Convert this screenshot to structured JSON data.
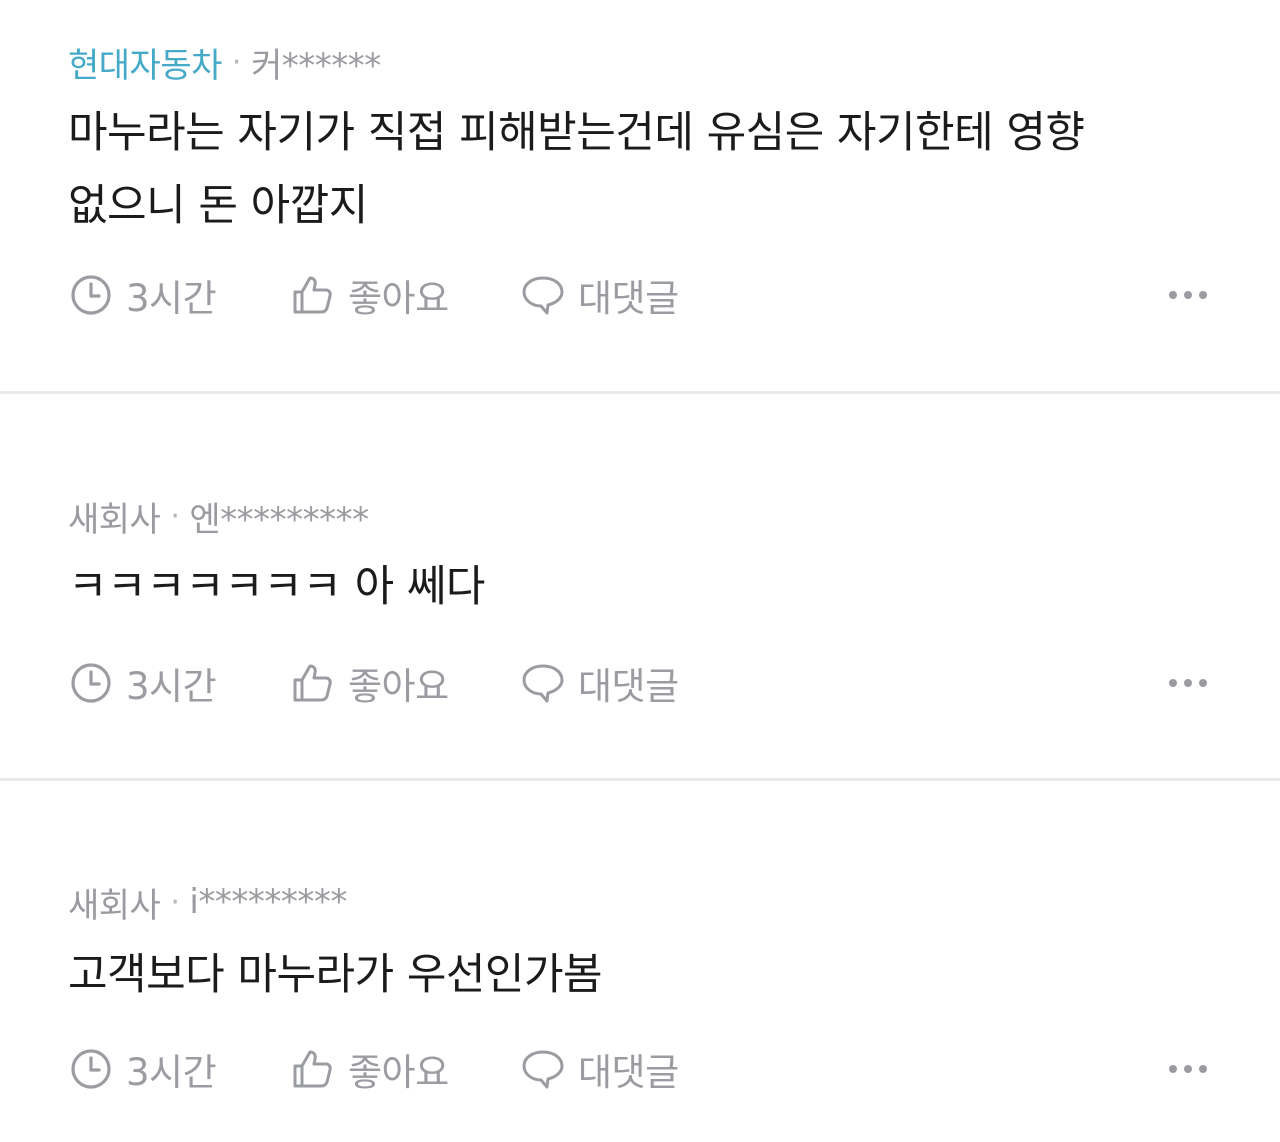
{
  "comments": [
    {
      "company": "현대자동차",
      "separator": "·",
      "author": "커******",
      "text": "마누라는 자기가 직접 피해받는건데 유심은 자기한테 영향\n없으니 돈 아깝지",
      "time": "3시간",
      "like_label": "좋아요",
      "reply_label": "대댓글",
      "accent_color": "#45a9c8"
    },
    {
      "company": "새회사",
      "separator": "·",
      "author": "엔*********",
      "text": "ㅋㅋㅋㅋㅋㅋㅋ 아 쎄다",
      "time": "3시간",
      "like_label": "좋아요",
      "reply_label": "대댓글"
    },
    {
      "company": "새회사",
      "separator": "·",
      "author": "i*********",
      "text": "고객보다 마누라가 우선인가봄",
      "time": "3시간",
      "like_label": "좋아요",
      "reply_label": "대댓글"
    }
  ],
  "icons": {
    "time": "clock-icon",
    "like": "thumbs-up-icon",
    "reply": "speech-bubble-icon",
    "more": "more-options-icon"
  }
}
